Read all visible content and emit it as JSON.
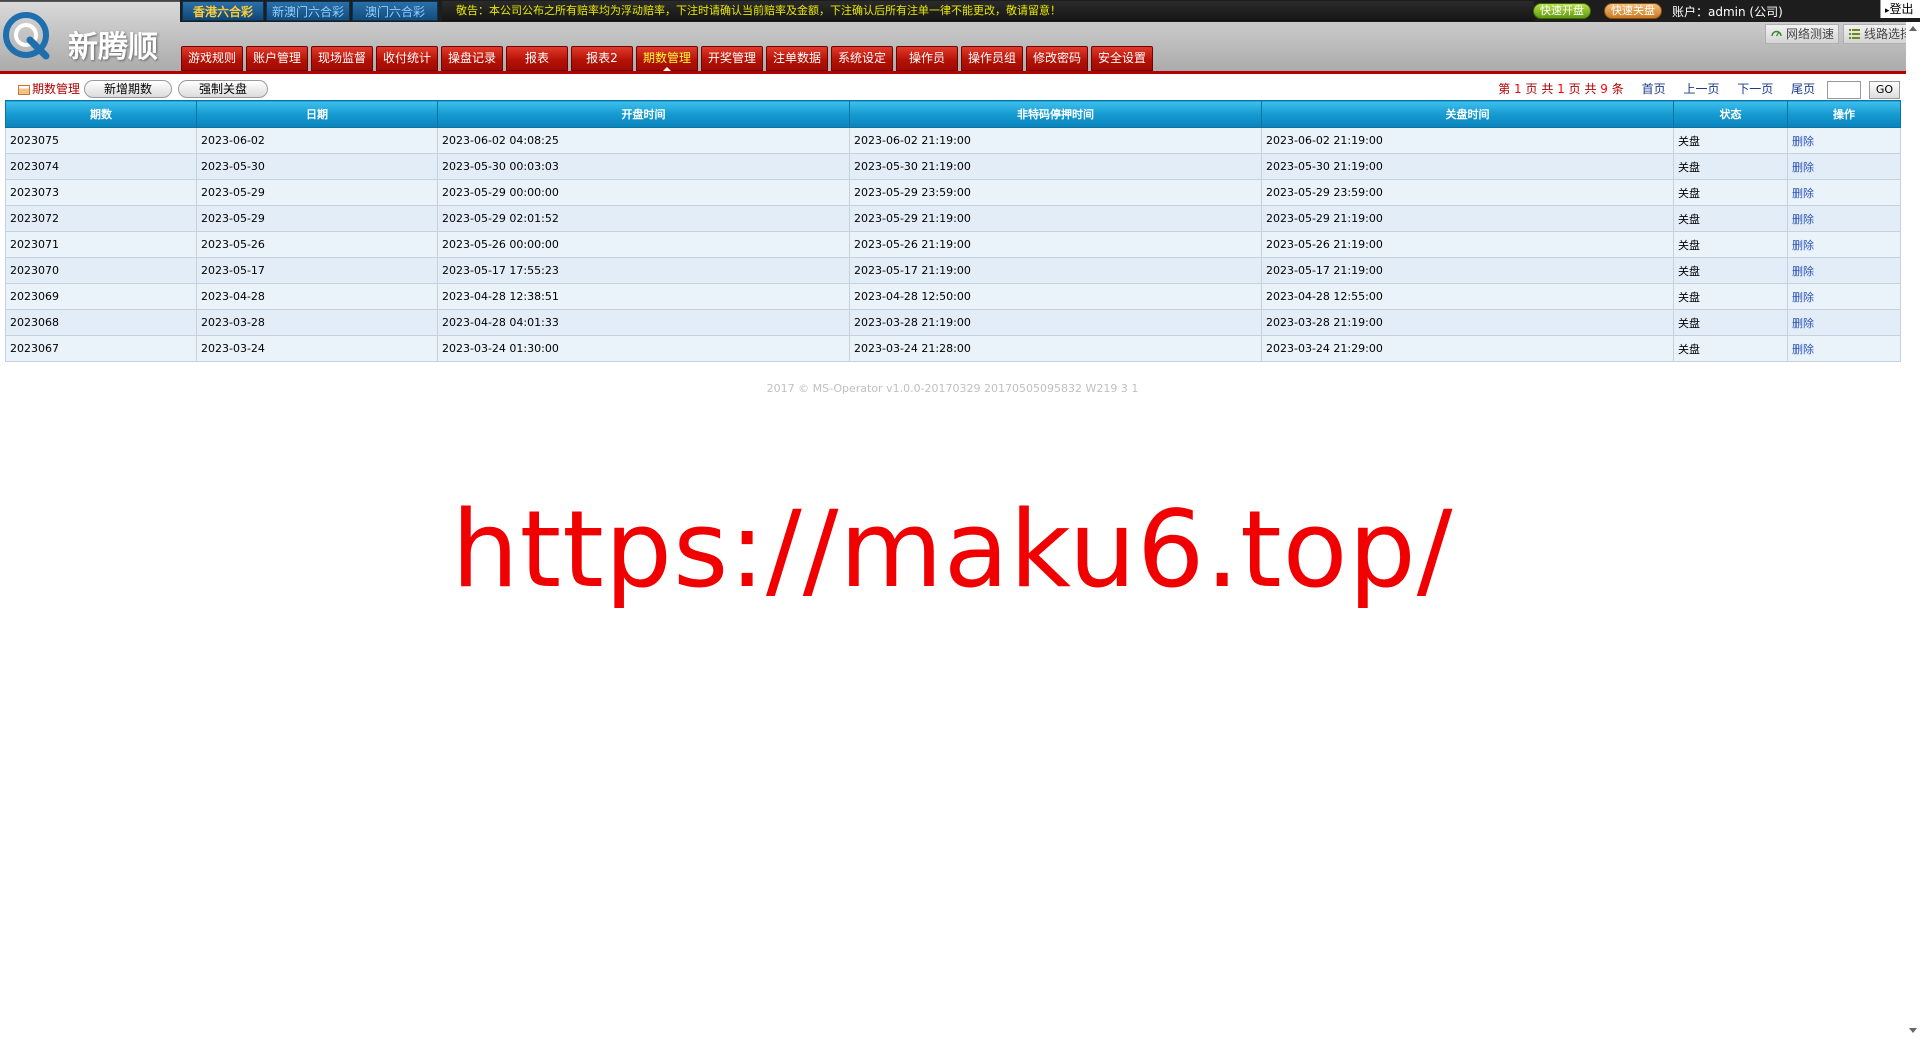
{
  "brand": {
    "name": "新腾顺"
  },
  "lottery_tabs": [
    {
      "label": "香港六合彩",
      "active": true
    },
    {
      "label": "新澳门六合彩",
      "active": false
    },
    {
      "label": "澳门六合彩",
      "active": false
    }
  ],
  "notice": "敬告：本公司公布之所有赔率均为浮动赔率，下注时请确认当前赔率及金额，下注确认后所有注单一律不能更改，敬请留意！",
  "quick": {
    "open_label": "快速开盘",
    "close_label": "快速关盘"
  },
  "account": {
    "text": "账户：admin (公司)"
  },
  "logout_label": "登出",
  "tools": {
    "speed_test": "网络测速",
    "line_select": "线路选择"
  },
  "nav": [
    {
      "label": "游戏规则",
      "active": false
    },
    {
      "label": "账户管理",
      "active": false
    },
    {
      "label": "现场监督",
      "active": false
    },
    {
      "label": "收付统计",
      "active": false
    },
    {
      "label": "操盘记录",
      "active": false
    },
    {
      "label": "报表",
      "active": false
    },
    {
      "label": "报表2",
      "active": false
    },
    {
      "label": "期数管理",
      "active": true
    },
    {
      "label": "开奖管理",
      "active": false
    },
    {
      "label": "注单数据",
      "active": false
    },
    {
      "label": "系统设定",
      "active": false
    },
    {
      "label": "操作员",
      "active": false
    },
    {
      "label": "操作员组",
      "active": false
    },
    {
      "label": "修改密码",
      "active": false
    },
    {
      "label": "安全设置",
      "active": false
    }
  ],
  "section": {
    "title": "期数管理",
    "add_label": "新增期数",
    "force_close_label": "强制关盘"
  },
  "pager": {
    "prefix": "第",
    "current": "1",
    "mid1": "页 共",
    "total_pages": "1",
    "mid2": "页 共",
    "total_records": "9",
    "suffix": "条",
    "first": "首页",
    "prev": "上一页",
    "next": "下一页",
    "last": "尾页",
    "go": "GO"
  },
  "table": {
    "headers": [
      "期数",
      "日期",
      "开盘时间",
      "非特码停押时间",
      "关盘时间",
      "状态",
      "操作"
    ],
    "rows": [
      [
        "2023075",
        "2023-06-02",
        "2023-06-02 04:08:25",
        "2023-06-02 21:19:00",
        "2023-06-02 21:19:00",
        "关盘",
        "删除"
      ],
      [
        "2023074",
        "2023-05-30",
        "2023-05-30 00:03:03",
        "2023-05-30 21:19:00",
        "2023-05-30 21:19:00",
        "关盘",
        "删除"
      ],
      [
        "2023073",
        "2023-05-29",
        "2023-05-29 00:00:00",
        "2023-05-29 23:59:00",
        "2023-05-29 23:59:00",
        "关盘",
        "删除"
      ],
      [
        "2023072",
        "2023-05-29",
        "2023-05-29 02:01:52",
        "2023-05-29 21:19:00",
        "2023-05-29 21:19:00",
        "关盘",
        "删除"
      ],
      [
        "2023071",
        "2023-05-26",
        "2023-05-26 00:00:00",
        "2023-05-26 21:19:00",
        "2023-05-26 21:19:00",
        "关盘",
        "删除"
      ],
      [
        "2023070",
        "2023-05-17",
        "2023-05-17 17:55:23",
        "2023-05-17 21:19:00",
        "2023-05-17 21:19:00",
        "关盘",
        "删除"
      ],
      [
        "2023069",
        "2023-04-28",
        "2023-04-28 12:38:51",
        "2023-04-28 12:50:00",
        "2023-04-28 12:55:00",
        "关盘",
        "删除"
      ],
      [
        "2023068",
        "2023-03-28",
        "2023-04-28 04:01:33",
        "2023-03-28 21:19:00",
        "2023-03-28 21:19:00",
        "关盘",
        "删除"
      ],
      [
        "2023067",
        "2023-03-24",
        "2023-03-24 01:30:00",
        "2023-03-24 21:28:00",
        "2023-03-24 21:29:00",
        "关盘",
        "删除"
      ]
    ]
  },
  "footer": "2017 © MS-Operator v1.0.0-20170329 20170505095832 W219 3 1",
  "watermark": "https://maku6.top/",
  "colors": {
    "nav_red": "#b31005",
    "header_blue": "#159ad1",
    "watermark_red": "#f00000",
    "link_blue": "#2a52b8"
  }
}
